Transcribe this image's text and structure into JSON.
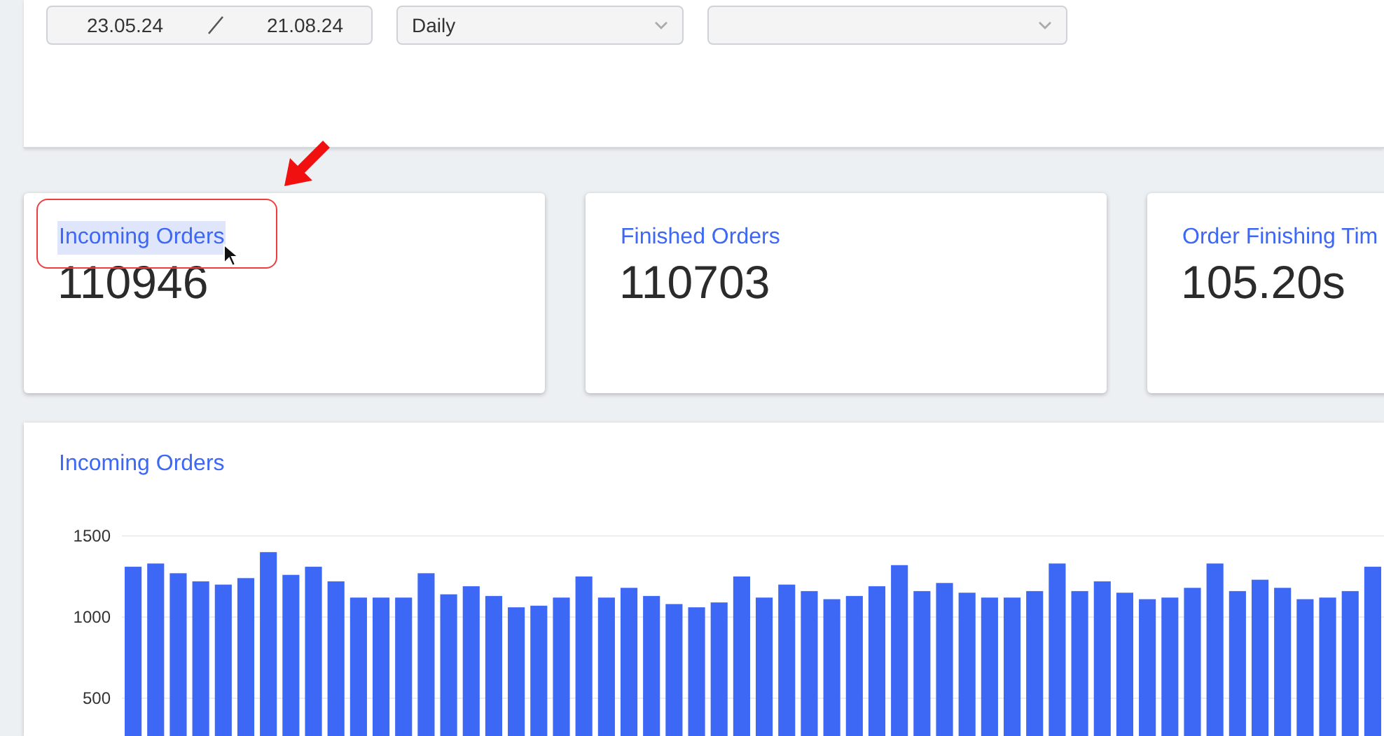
{
  "filters": [
    {
      "kind": "date-range",
      "start": "23.05.24",
      "end": "21.08.24"
    },
    {
      "kind": "select",
      "value": "Daily"
    },
    {
      "kind": "select"
    }
  ],
  "kpis": [
    {
      "title": "Incoming Orders",
      "value": "110946",
      "selected": true,
      "annotated": true
    },
    {
      "title": "Finished Orders",
      "value": "110703",
      "selected": false,
      "annotated": false
    },
    {
      "title": "Order Finishing Tim",
      "value": "105.20s",
      "selected": false,
      "annotated": false
    }
  ],
  "chart": {
    "title": "Incoming Orders",
    "chart_data": {
      "type": "bar",
      "ylim": [
        0,
        1500
      ],
      "yticks": [
        500,
        1000,
        1500
      ],
      "values": [
        1310,
        1330,
        1270,
        1220,
        1200,
        1240,
        1400,
        1260,
        1310,
        1220,
        1120,
        1120,
        1120,
        1270,
        1140,
        1190,
        1130,
        1060,
        1070,
        1120,
        1250,
        1120,
        1180,
        1130,
        1080,
        1060,
        1090,
        1250,
        1120,
        1200,
        1160,
        1110,
        1130,
        1190,
        1320,
        1160,
        1210,
        1150,
        1120,
        1120,
        1160,
        1330,
        1160,
        1220,
        1150,
        1110,
        1120,
        1180,
        1330,
        1160,
        1230,
        1180,
        1110,
        1120,
        1160,
        1310
      ]
    }
  }
}
